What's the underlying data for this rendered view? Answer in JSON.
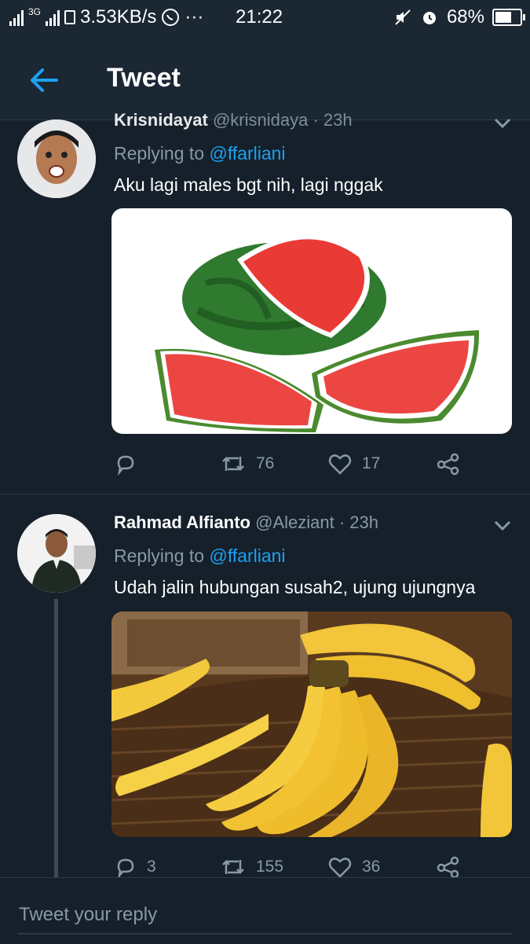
{
  "status_bar": {
    "network_label": "3G",
    "speed": "3.53KB/s",
    "more": "···",
    "time": "21:22",
    "battery": "68%"
  },
  "header": {
    "title": "Tweet"
  },
  "tweets": [
    {
      "name": "Krisnidayat",
      "handle": "@krisnidaya",
      "time": "· 23h",
      "replying_prefix": "Replying to",
      "replying_to": "@ffarliani",
      "text": "Aku lagi males bgt nih, lagi nggak",
      "media_subject": "watermelon",
      "replies": "",
      "retweets": "76",
      "likes": "17"
    },
    {
      "name": "Rahmad Alfianto",
      "handle": "@Aleziant",
      "time": "· 23h",
      "replying_prefix": "Replying to",
      "replying_to": "@ffarliani",
      "text": "Udah jalin hubungan susah2, ujung ujungnya",
      "media_subject": "bananas",
      "replies": "3",
      "retweets": "155",
      "likes": "36"
    }
  ],
  "reply_bar": {
    "placeholder": "Tweet your reply"
  },
  "colors": {
    "background": "#15202b",
    "accent": "#1da1f2",
    "muted": "#8899a6"
  }
}
